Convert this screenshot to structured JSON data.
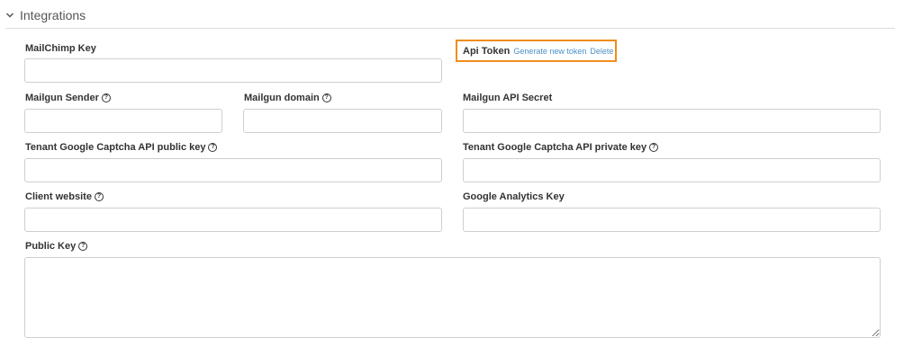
{
  "section": {
    "title": "Integrations",
    "collapse_icon": "chevron-down-icon"
  },
  "fields": {
    "mailchimp_key": {
      "label": "MailChimp Key",
      "value": ""
    },
    "api_token": {
      "label": "Api Token",
      "generate_label": "Generate new token",
      "delete_label": "Delete"
    },
    "mailgun_sender": {
      "label": "Mailgun Sender",
      "help_icon": "help-circle-icon",
      "value": ""
    },
    "mailgun_domain": {
      "label": "Mailgun domain",
      "help_icon": "help-circle-icon",
      "value": ""
    },
    "mailgun_api_secret": {
      "label": "Mailgun API Secret",
      "value": ""
    },
    "captcha_public": {
      "label": "Tenant Google Captcha API public key",
      "help_icon": "help-circle-icon",
      "value": ""
    },
    "captcha_private": {
      "label": "Tenant Google Captcha API private key",
      "help_icon": "help-circle-icon",
      "value": ""
    },
    "client_website": {
      "label": "Client website",
      "help_icon": "help-circle-icon",
      "value": ""
    },
    "google_analytics": {
      "label": "Google Analytics Key",
      "value": ""
    },
    "public_key": {
      "label": "Public Key",
      "help_icon": "help-circle-icon",
      "value": ""
    }
  },
  "colors": {
    "highlight_border": "#f08c1e",
    "link": "#4a90c8",
    "input_border": "#cfcfcf"
  }
}
